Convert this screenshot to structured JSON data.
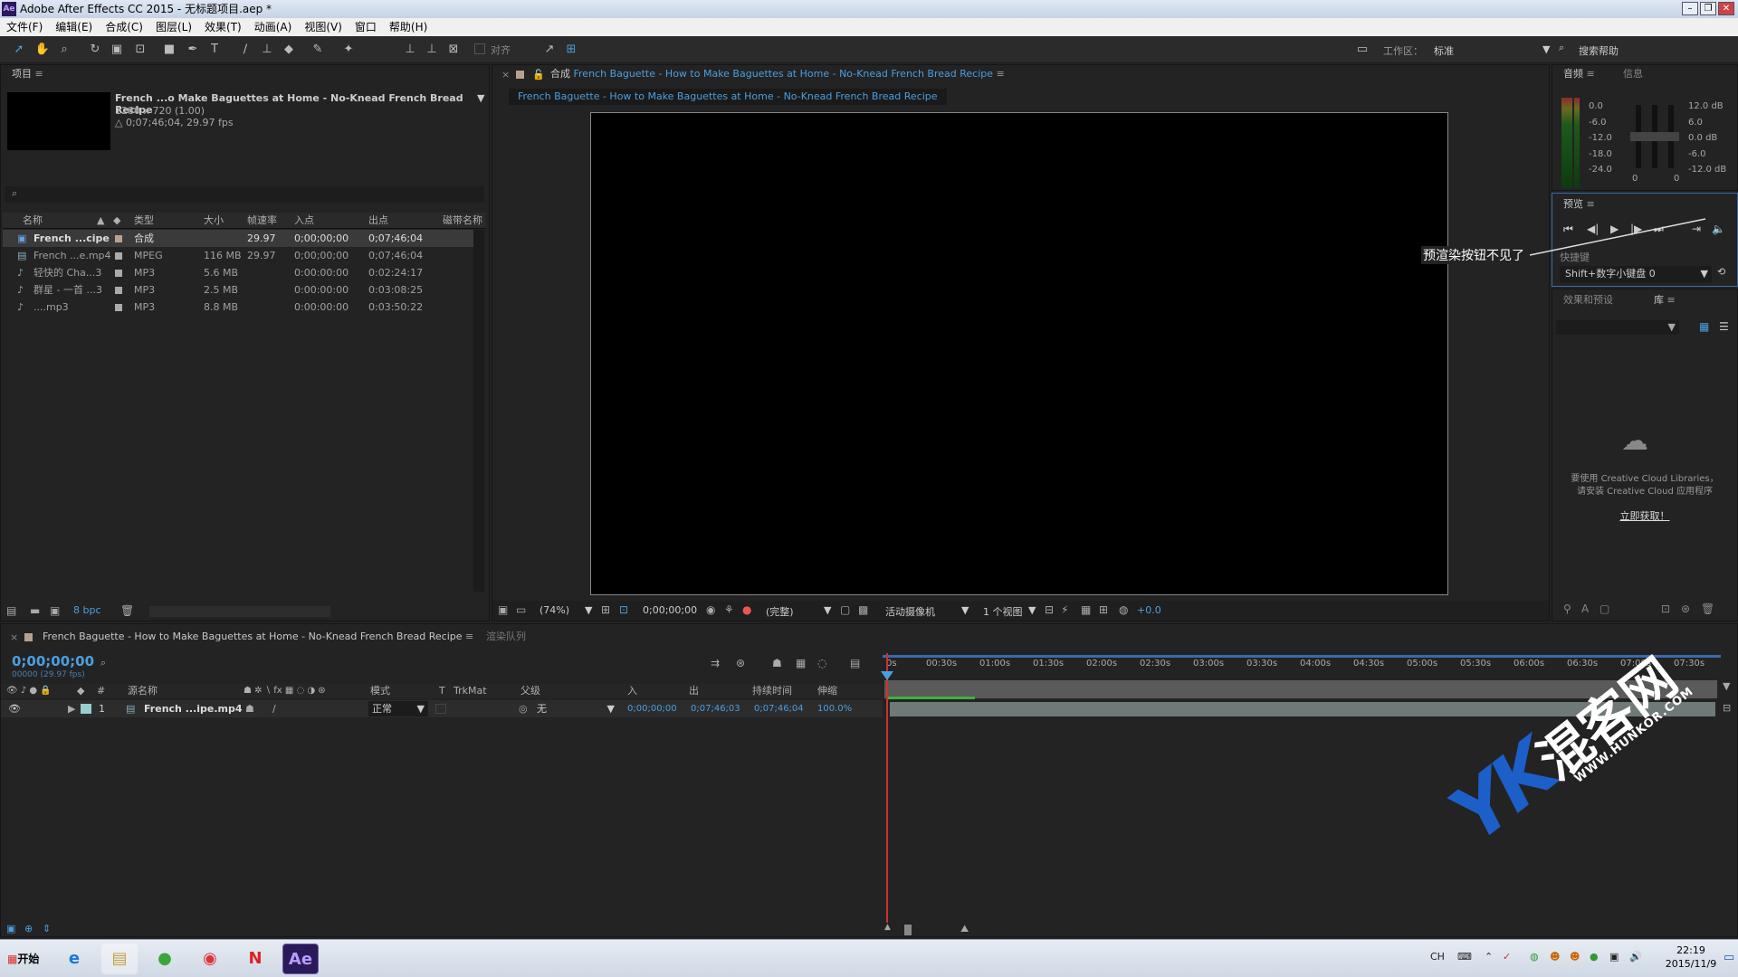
{
  "window": {
    "title": "Adobe After Effects CC 2015 - 无标题项目.aep *",
    "logo": "Ae"
  },
  "menu": [
    "文件(F)",
    "编辑(E)",
    "合成(C)",
    "图层(L)",
    "效果(T)",
    "动画(A)",
    "视图(V)",
    "窗口",
    "帮助(H)"
  ],
  "toolbar": {
    "align_label": "对齐",
    "workspace_label": "工作区：",
    "workspace_value": "标准",
    "search_help": "搜索帮助"
  },
  "project": {
    "tab": "项目",
    "selected_name": "French ...o Make Baguettes at Home - No-Knead French Bread Recipe",
    "selected_res": "1280 x 720 (1.00)",
    "selected_dur": "△ 0;07;46;04, 29.97 fps",
    "columns": [
      "名称",
      "类型",
      "大小",
      "帧速率",
      "入点",
      "出点",
      "磁带名称"
    ],
    "items": [
      {
        "name": "French ...cipe",
        "type": "合成",
        "size": "",
        "fps": "29.97",
        "in": "0;00;00;00",
        "out": "0;07;46;04"
      },
      {
        "name": "French ...e.mp4",
        "type": "MPEG",
        "size": "116 MB",
        "fps": "29.97",
        "in": "0;00;00;00",
        "out": "0;07;46;04"
      },
      {
        "name": "轻快的 Cha...3",
        "type": "MP3",
        "size": "5.6 MB",
        "fps": "",
        "in": "0:00:00:00",
        "out": "0:02:24:17"
      },
      {
        "name": "群星 - 一首 ...3",
        "type": "MP3",
        "size": "2.5 MB",
        "fps": "",
        "in": "0:00:00:00",
        "out": "0:03:08:25"
      },
      {
        "name": "....mp3",
        "type": "MP3",
        "size": "8.8 MB",
        "fps": "",
        "in": "0:00:00:00",
        "out": "0:03:50:22"
      }
    ],
    "bpc": "8 bpc"
  },
  "comp": {
    "tab_prefix": "合成",
    "tab_name": "French Baguette - How to Make Baguettes at Home - No-Knead French Bread Recipe",
    "breadcrumb": "French Baguette - How to Make Baguettes at Home - No-Knead French Bread Recipe",
    "zoom": "(74%)",
    "timecode": "0;00;00;00",
    "quality": "(完整)",
    "camera": "活动摄像机",
    "views": "1 个视图",
    "exposure": "+0.0"
  },
  "audio": {
    "tab": "音频",
    "info_tab": "信息",
    "left_scale": [
      "0.0",
      "-6.0",
      "-12.0",
      "-18.0",
      "-24.0"
    ],
    "right_scale": [
      "12.0 dB",
      "6.0",
      "0.0 dB",
      "-6.0",
      "-12.0 dB"
    ],
    "zero_left": "0",
    "zero_right": "0"
  },
  "preview": {
    "tab": "预览",
    "shortcut_label": "快捷键",
    "shortcut_value": "Shift+数字小键盘 0",
    "annotation": "预渲染按钮不见了"
  },
  "effects": {
    "tab": "效果和预设",
    "lib_tab": "库",
    "cc_message1": "要使用 Creative Cloud Libraries，",
    "cc_message2": "请安装 Creative Cloud 应用程序",
    "cc_link": "立即获取！"
  },
  "timeline": {
    "tab": "French Baguette - How to Make Baguettes at Home - No-Knead French Bread Recipe",
    "render_queue": "渲染队列",
    "timecode": "0;00;00;00",
    "frames": "00000 (29.97 fps)",
    "columns": [
      "源名称",
      "模式",
      "T",
      "TrkMat",
      "父级",
      "入",
      "出",
      "持续时间",
      "伸缩"
    ],
    "layer": {
      "num": "1",
      "name": "French ...ipe.mp4",
      "mode": "正常",
      "parent": "无",
      "in": "0;00;00;00",
      "out": "0;07;46;03",
      "duration": "0;07;46;04",
      "stretch": "100.0%"
    },
    "ruler": [
      "0s",
      "00:30s",
      "01:00s",
      "01:30s",
      "02:00s",
      "02:30s",
      "03:00s",
      "03:30s",
      "04:00s",
      "04:30s",
      "05:00s",
      "05:30s",
      "06:00s",
      "06:30s",
      "07:00s",
      "07:30s"
    ]
  },
  "watermark": {
    "text": "混客网",
    "url": "WWW.HUNKOR.COM"
  },
  "taskbar": {
    "start": "开始",
    "lang": "CH",
    "time": "22:19",
    "date": "2015/11/9",
    "ae_label": "Ae"
  }
}
